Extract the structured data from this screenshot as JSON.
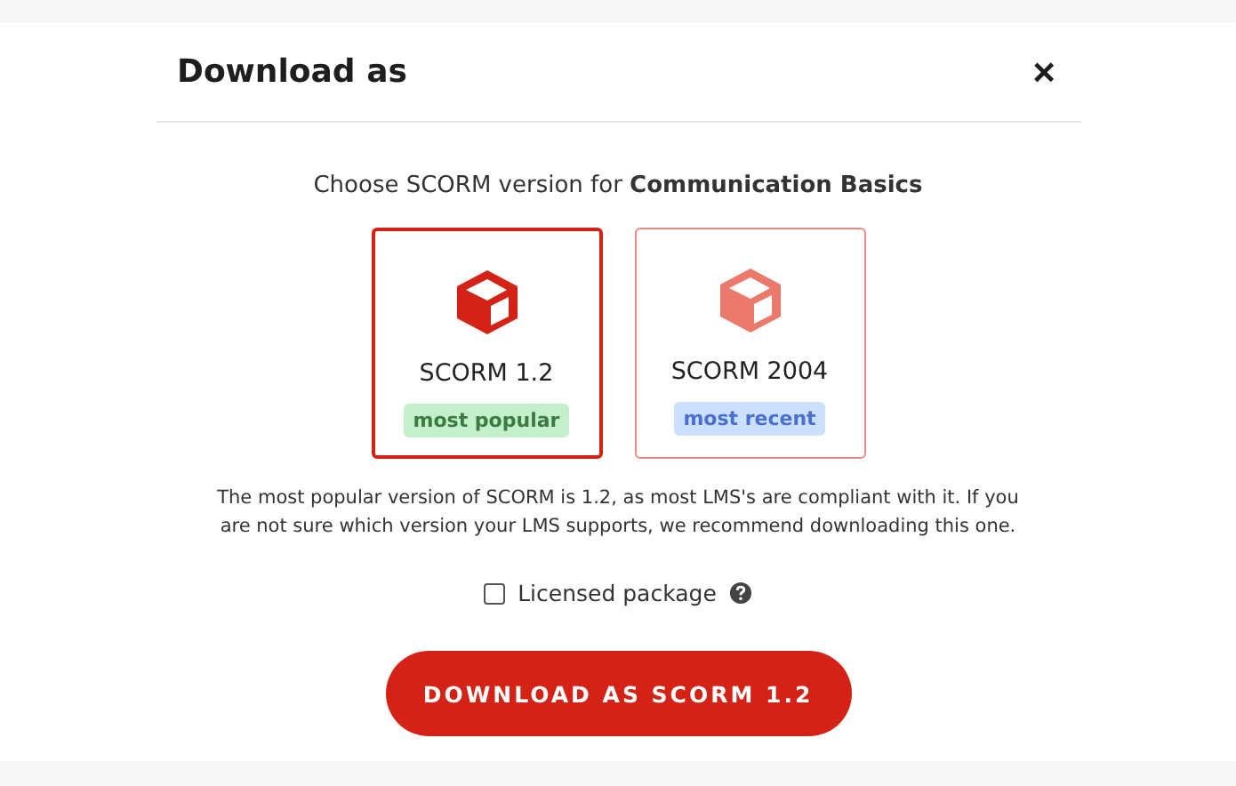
{
  "dialog": {
    "title": "Download as",
    "close": "×"
  },
  "prompt": "Choose SCORM version for **Communication Basics**",
  "options": [
    {
      "label": "SCORM 1.2",
      "badge": "most popular",
      "color": "#c3f0c8",
      "selected": true
    },
    {
      "label": "SCORM 2004",
      "badge": "most recent",
      "color": "#cbe0fc",
      "selected": false
    }
  ],
  "description": "The most popular version of SCORM is 1.2, as most LMS's are compliant with it. If you are not sure which version your LMS supports, we recommend downloading this one.",
  "licensed": {
    "label": "Licensed package",
    "checked": false
  },
  "button": "DOWNLOAD AS SCORM 1.2"
}
